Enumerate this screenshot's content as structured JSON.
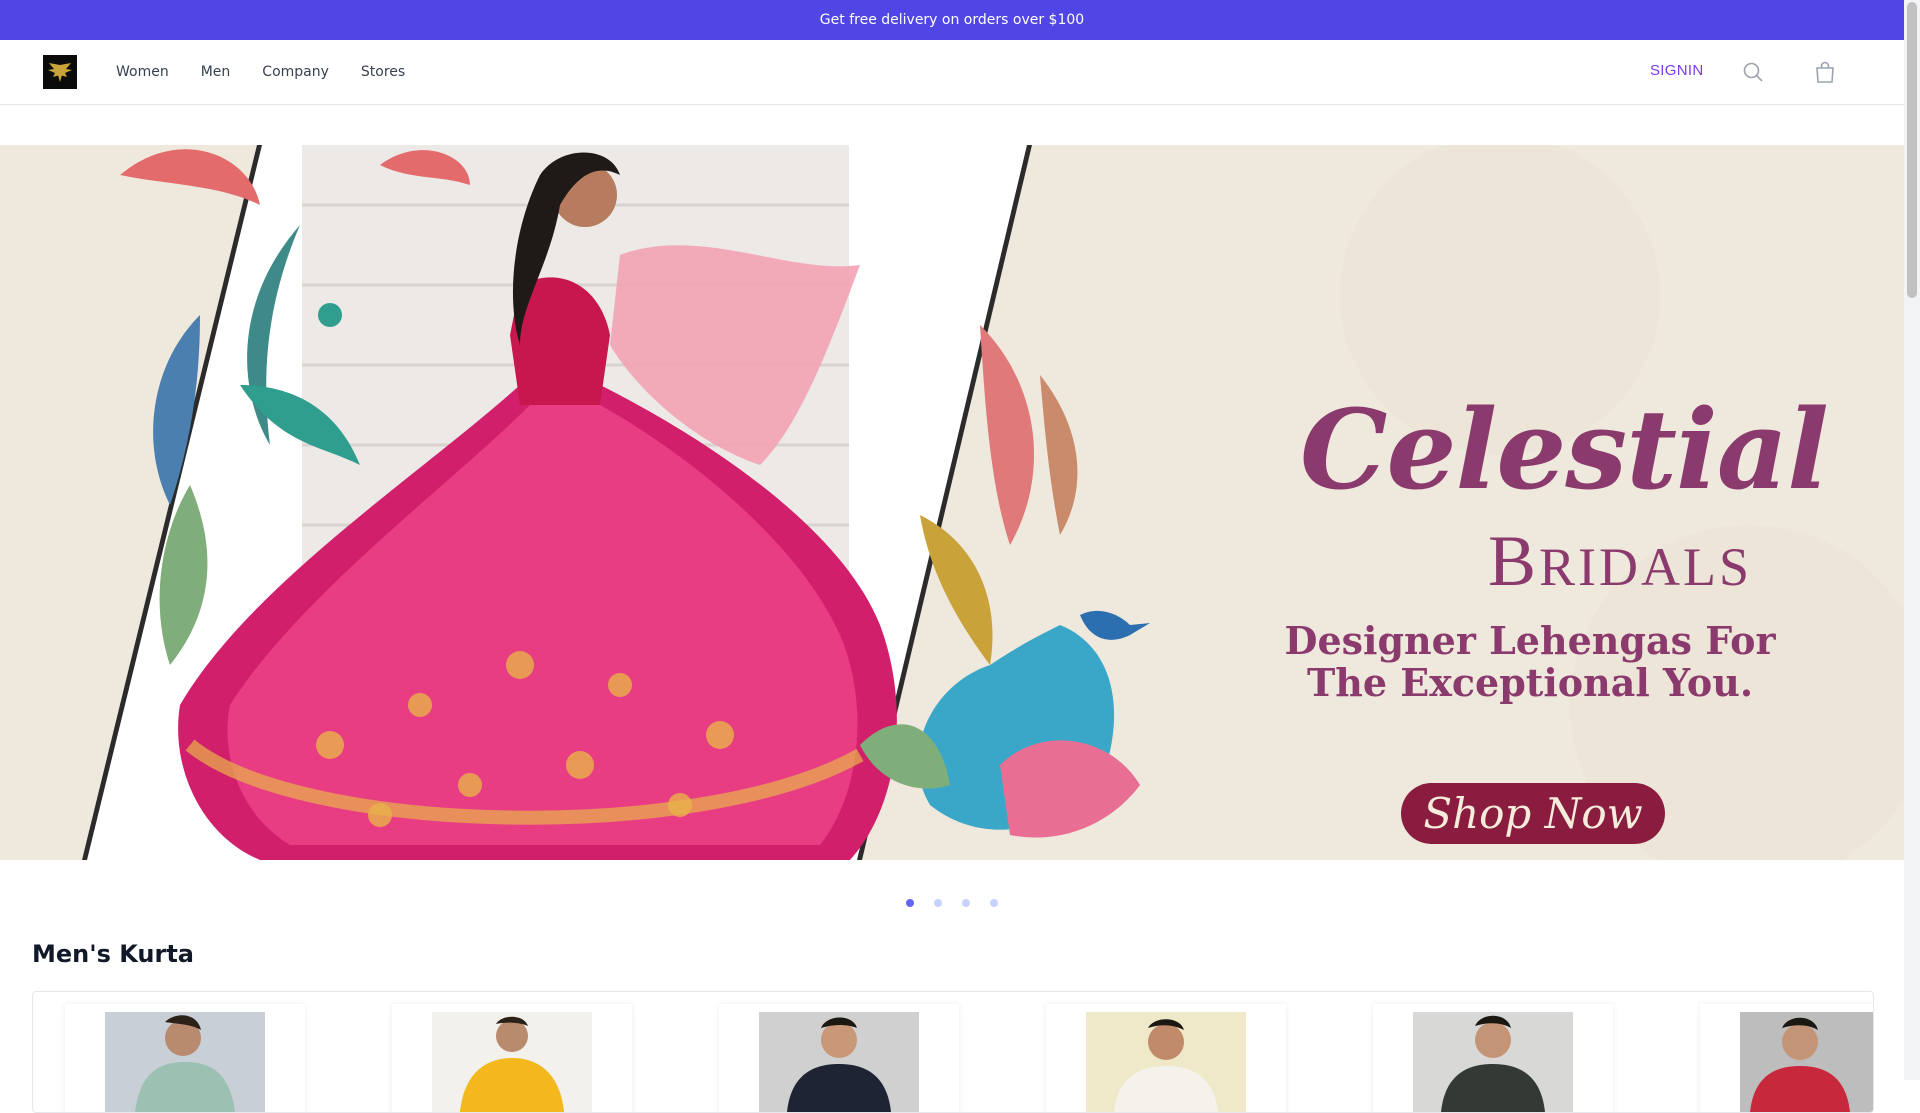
{
  "promo": {
    "text": "Get free delivery on orders over $100"
  },
  "nav": {
    "links": [
      "Women",
      "Men",
      "Company",
      "Stores"
    ],
    "signin": "SIGNIN",
    "icons": {
      "search": "search-icon",
      "bag": "shopping-bag-icon",
      "logo": "eagle-logo-icon"
    }
  },
  "hero": {
    "title_line1": "Celestial",
    "title_line2_initial": "B",
    "title_line2_rest": "RIDALS",
    "subtitle": "Designer Lehengas For The Exceptional You.",
    "cta": "Shop Now",
    "slides_total": 4,
    "active_slide": 1
  },
  "section": {
    "title": "Men's Kurta"
  },
  "colors": {
    "brand": "#4f46e5",
    "hero_text": "#8b3a6e",
    "cta_bg": "#8a1c3f",
    "signin": "#7c3aed"
  },
  "products": [
    {
      "shirt": "#9cc1b2",
      "bg": "#c9cfd6"
    },
    {
      "shirt": "#f2b81e",
      "bg": "#f3f1ec"
    },
    {
      "shirt": "#1e2433",
      "bg": "#cfd0cf"
    },
    {
      "shirt": "#f4f2ea",
      "bg": "#efe9c9"
    },
    {
      "shirt": "#333a36",
      "bg": "#d8d8d6"
    },
    {
      "shirt": "#c8283b",
      "bg": "#bdbdbd"
    }
  ]
}
